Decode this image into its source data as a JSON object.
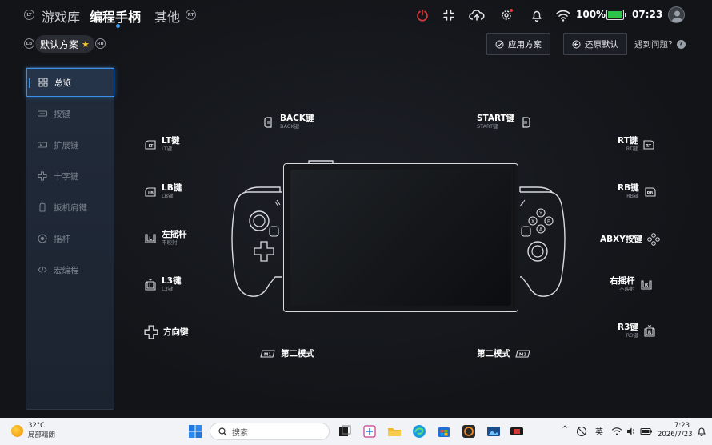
{
  "topnav": {
    "lb": "LT",
    "rb": "RT",
    "tabs": [
      {
        "label": "游戏库",
        "active": false
      },
      {
        "label": "编程手柄",
        "active": true
      },
      {
        "label": "其他",
        "active": false
      }
    ],
    "battery_percent": "100%",
    "battery_level": 1.0,
    "time": "07:23"
  },
  "scheme": {
    "lb": "LB",
    "rb": "RB",
    "name": "默认方案",
    "apply_label": "应用方案",
    "reset_label": "还原默认",
    "help_label": "遇到问题?"
  },
  "sidebar": {
    "items": [
      {
        "label": "总览",
        "icon": "grid-icon",
        "active": true
      },
      {
        "label": "按键",
        "icon": "keyboard-icon",
        "active": false
      },
      {
        "label": "扩展键",
        "icon": "extension-key-icon",
        "active": false
      },
      {
        "label": "十字键",
        "icon": "dpad-icon",
        "active": false
      },
      {
        "label": "扳机肩键",
        "icon": "trigger-icon",
        "active": false
      },
      {
        "label": "摇杆",
        "icon": "joystick-icon",
        "active": false
      },
      {
        "label": "宏编程",
        "icon": "code-icon",
        "active": false
      }
    ]
  },
  "mapping": {
    "back": {
      "main": "BACK键",
      "sub": "BACK键"
    },
    "start": {
      "main": "START键",
      "sub": "START键"
    },
    "lt": {
      "main": "LT键",
      "sub": "LT键",
      "badge": "LT"
    },
    "lb": {
      "main": "LB键",
      "sub": "LB键",
      "badge": "LB"
    },
    "ls": {
      "main": "左摇杆",
      "sub": "不映射",
      "badge": "L"
    },
    "l3": {
      "main": "L3键",
      "sub": "L3键",
      "badge": "L"
    },
    "dpad": {
      "main": "方向键"
    },
    "m1": {
      "main": "第二模式",
      "badge": "M1"
    },
    "m2": {
      "main": "第二模式",
      "badge": "M2"
    },
    "rt": {
      "main": "RT键",
      "sub": "RT键",
      "badge": "RT"
    },
    "rb": {
      "main": "RB键",
      "sub": "RB键",
      "badge": "RB"
    },
    "abxy": {
      "main": "ABXY按键"
    },
    "rs": {
      "main": "右摇杆",
      "sub": "不映射",
      "badge": "R"
    },
    "r3": {
      "main": "R3键",
      "sub": "R3键",
      "badge": "R"
    }
  },
  "device": {
    "buttons": [
      "X",
      "Y",
      "B",
      "A"
    ]
  },
  "taskbar": {
    "weather_temp": "32°C",
    "weather_desc": "局部晴朗",
    "search_placeholder": "搜索",
    "ime": "英",
    "time": "7:23",
    "date": "2026/7/23"
  },
  "colors": {
    "accent": "#3c8fe8",
    "power": "#e23b3b",
    "battery_fill": "#2ec24a",
    "star": "#f4c430"
  }
}
